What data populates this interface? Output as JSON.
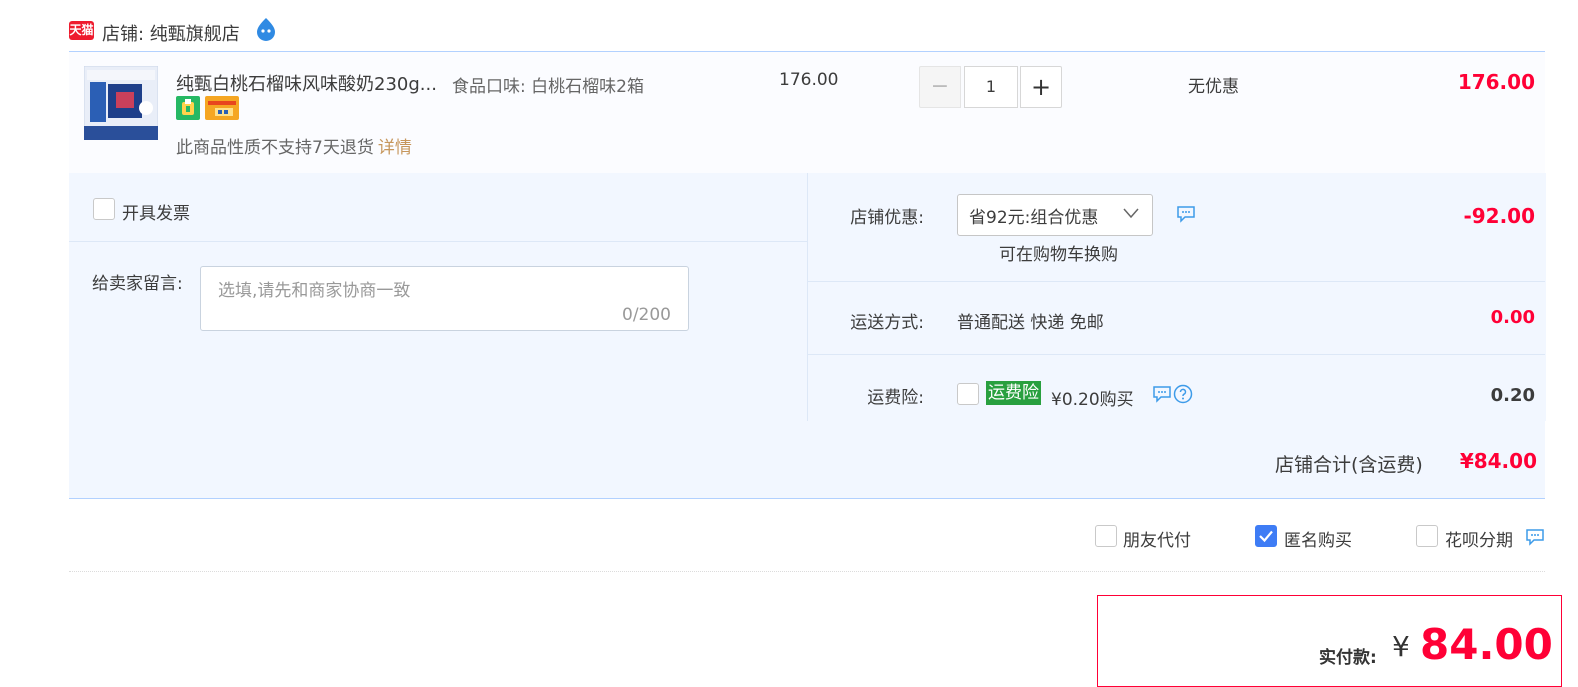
{
  "shop": {
    "badge": "天猫",
    "name": "店铺: 纯甄旗舰店",
    "chat_icon": "wangwang-chat-icon"
  },
  "item": {
    "title": "纯甄白桃石榴味风味酸奶230g...",
    "sku": "食品口味: 白桃石榴味2箱",
    "unit_price": "176.00",
    "quantity": "1",
    "qty_minus": "−",
    "qty_plus": "+",
    "discount": "无优惠",
    "subtotal": "176.00",
    "return_note": "此商品性质不支持7天退货",
    "detail_link": "详情"
  },
  "options": {
    "invoice_label": "开具发票",
    "message_label": "给卖家留言:",
    "message_placeholder": "选填,请先和商家协商一致",
    "message_count": "0/200"
  },
  "coupon": {
    "label": "店铺优惠:",
    "selected": "省92元:组合优惠",
    "note": "可在购物车换购",
    "amount": "-92.00"
  },
  "shipping": {
    "label": "运送方式:",
    "method": "普通配送 快递 免邮",
    "amount": "0.00"
  },
  "insurance": {
    "label": "运费险:",
    "badge": "运费险",
    "price": "¥0.20购买",
    "amount": "0.20"
  },
  "shop_total": {
    "label": "店铺合计(含运费)",
    "amount": "¥84.00"
  },
  "payment_options": {
    "friend_pay": "朋友代付",
    "anonymous": "匿名购买",
    "anonymous_checked": true,
    "huabei": "花呗分期"
  },
  "actual_payment": {
    "label": "实付款:",
    "currency": "¥",
    "amount": "84.00"
  },
  "colors": {
    "price_red": "#ff0036",
    "panel_bg": "#f2f7ff",
    "check_blue": "#3e7cf5",
    "insurance_green": "#29a03f",
    "tmall_red": "#ee1b2e",
    "link_gold": "#c6965b"
  }
}
